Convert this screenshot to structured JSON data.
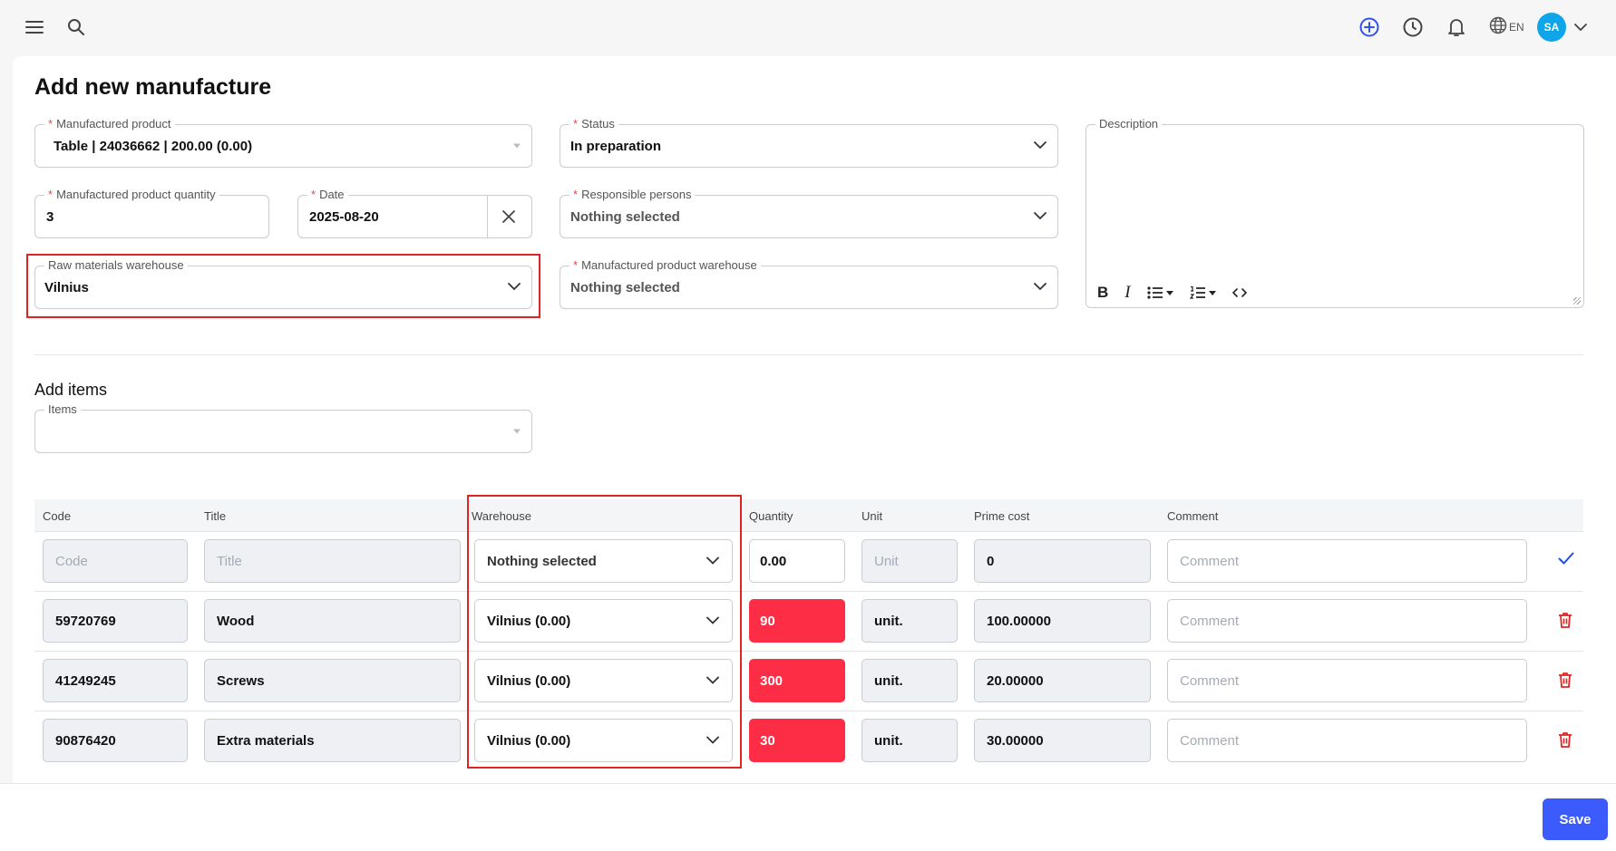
{
  "topbar": {
    "lang": "EN",
    "avatar": "SA"
  },
  "page_title": "Add new manufacture",
  "form": {
    "manufactured_product": {
      "label": "Manufactured product",
      "value": "Table | 24036662 | 200.00 (0.00)"
    },
    "status": {
      "label": "Status",
      "value": "In preparation"
    },
    "description": {
      "label": "Description"
    },
    "quantity": {
      "label": "Manufactured product quantity",
      "value": "3"
    },
    "date": {
      "label": "Date",
      "value": "2025-08-20"
    },
    "responsible": {
      "label": "Responsible persons",
      "value": "Nothing selected"
    },
    "raw_warehouse": {
      "label": "Raw materials warehouse",
      "value": "Vilnius"
    },
    "product_warehouse": {
      "label": "Manufactured product warehouse",
      "value": "Nothing selected"
    },
    "required_mark": "*"
  },
  "items_section": {
    "title": "Add items",
    "items_label": "Items"
  },
  "table": {
    "headers": {
      "code": "Code",
      "title": "Title",
      "warehouse": "Warehouse",
      "quantity": "Quantity",
      "unit": "Unit",
      "prime_cost": "Prime cost",
      "comment": "Comment"
    },
    "new_row": {
      "code_ph": "Code",
      "title_ph": "Title",
      "warehouse": "Nothing selected",
      "quantity": "0.00",
      "unit_ph": "Unit",
      "prime_cost": "0",
      "comment_ph": "Comment"
    },
    "rows": [
      {
        "code": "59720769",
        "title": "Wood",
        "warehouse": "Vilnius (0.00)",
        "quantity": "90",
        "unit": "unit.",
        "prime_cost": "100.00000",
        "comment_ph": "Comment"
      },
      {
        "code": "41249245",
        "title": "Screws",
        "warehouse": "Vilnius (0.00)",
        "quantity": "300",
        "unit": "unit.",
        "prime_cost": "20.00000",
        "comment_ph": "Comment"
      },
      {
        "code": "90876420",
        "title": "Extra materials",
        "warehouse": "Vilnius (0.00)",
        "quantity": "30",
        "unit": "unit.",
        "prime_cost": "30.00000",
        "comment_ph": "Comment"
      }
    ]
  },
  "footer": {
    "save_label": "Save"
  },
  "colors": {
    "accent": "#3b5bfd",
    "danger": "#fe2d46",
    "highlight": "#e02424",
    "avatar_bg": "#0ea5e9"
  },
  "icons": [
    "menu-icon",
    "search-icon",
    "plus-circle-icon",
    "clock-icon",
    "bell-icon",
    "globe-icon",
    "chevron-down-icon",
    "close-icon",
    "check-icon",
    "trash-icon"
  ]
}
